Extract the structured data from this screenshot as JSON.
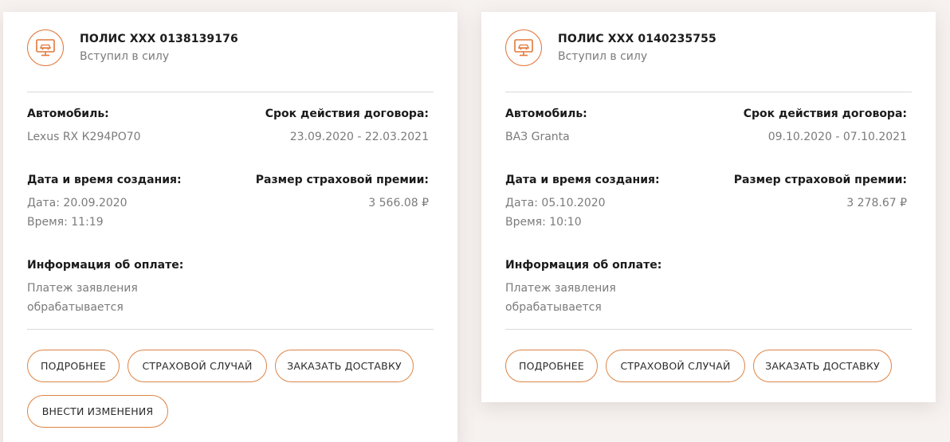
{
  "policies": [
    {
      "title": "ПОЛИС XXX 0138139176",
      "status": "Вступил в силу",
      "car_label": "Автомобиль:",
      "car_value": "Lexus RX К294РО70",
      "term_label": "Срок действия договора:",
      "term_value": "23.09.2020 - 22.03.2021",
      "created_label": "Дата и время создания:",
      "created_date": "Дата: 20.09.2020",
      "created_time": "Время: 11:19",
      "premium_label": "Размер страховой премии:",
      "premium_value": "3 566.08 ₽",
      "payment_label": "Информация об оплате:",
      "payment_line1": "Платеж заявления",
      "payment_line2": "обрабатывается",
      "buttons": {
        "details": "ПОДРОБНЕЕ",
        "insured_event": "СТРАХОВОЙ СЛУЧАЙ",
        "order_delivery": "ЗАКАЗАТЬ ДОСТАВКУ",
        "make_changes": "ВНЕСТИ ИЗМЕНЕНИЯ"
      }
    },
    {
      "title": "ПОЛИС XXX 0140235755",
      "status": "Вступил в силу",
      "car_label": "Автомобиль:",
      "car_value": "ВАЗ Granta",
      "term_label": "Срок действия договора:",
      "term_value": "09.10.2020 - 07.10.2021",
      "created_label": "Дата и время создания:",
      "created_date": "Дата: 05.10.2020",
      "created_time": "Время: 10:10",
      "premium_label": "Размер страховой премии:",
      "premium_value": "3 278.67 ₽",
      "payment_label": "Информация об оплате:",
      "payment_line1": "Платеж заявления",
      "payment_line2": "обрабатывается",
      "buttons": {
        "details": "ПОДРОБНЕЕ",
        "insured_event": "СТРАХОВОЙ СЛУЧАЙ",
        "order_delivery": "ЗАКАЗАТЬ ДОСТАВКУ"
      }
    }
  ],
  "icons": {
    "policy": "car-monitor-icon"
  },
  "colors": {
    "accent": "#e2783a",
    "text": "#1b1b1b",
    "muted": "#7b7b7b",
    "divider": "#d9d9d9"
  }
}
